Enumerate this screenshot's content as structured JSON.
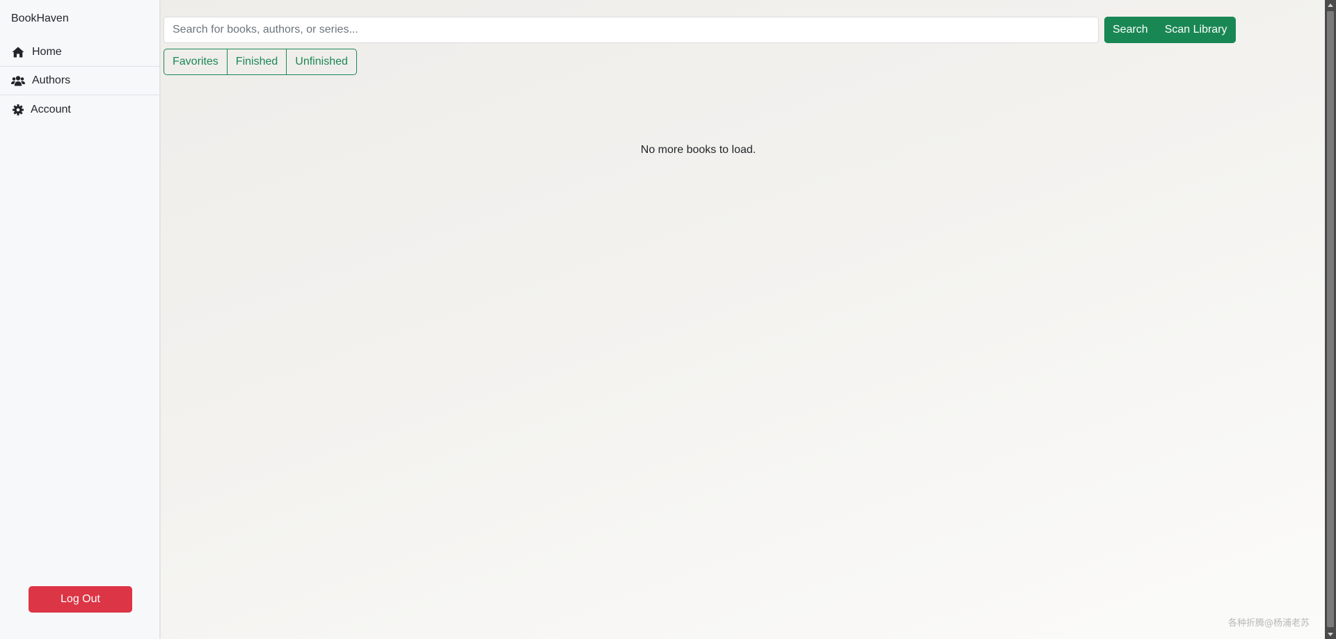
{
  "app": {
    "brand": "BookHaven"
  },
  "sidebar": {
    "items": [
      {
        "label": "Home",
        "icon": "home-icon"
      },
      {
        "label": "Authors",
        "icon": "users-icon"
      },
      {
        "label": "Account",
        "icon": "gear-icon"
      }
    ],
    "logout_label": "Log Out"
  },
  "search": {
    "placeholder": "Search for books, authors, or series...",
    "value": "",
    "search_label": "Search",
    "scan_label": "Scan Library"
  },
  "filters": [
    "Favorites",
    "Finished",
    "Unfinished"
  ],
  "main": {
    "empty_message": "No more books to load."
  },
  "watermark": "各种折腾@杨浦老苏",
  "colors": {
    "accent": "#198754",
    "danger": "#dc3545",
    "sidebar_bg": "#f7f8fa",
    "text": "#212529"
  }
}
